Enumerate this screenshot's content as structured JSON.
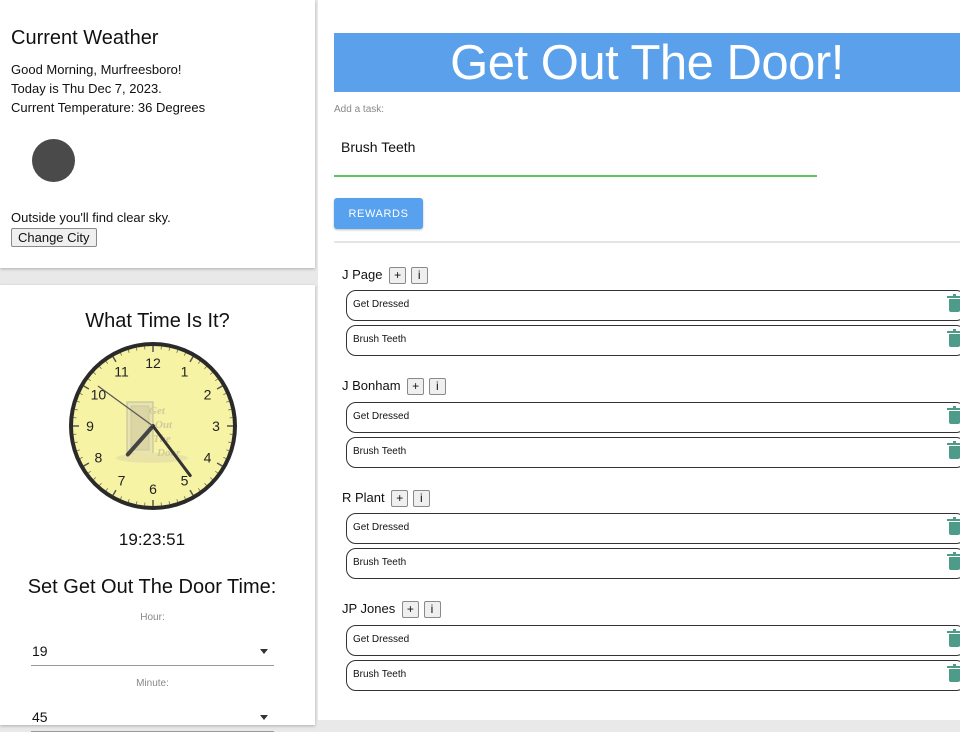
{
  "weather": {
    "title": "Current Weather",
    "greeting": "Good Morning, Murfreesboro!",
    "date_line": "Today is Thu Dec 7, 2023.",
    "temperature_line": "Current Temperature: 36 Degrees",
    "icon": "weather-condition-icon",
    "condition_line": "Outside you'll find clear sky.",
    "change_city_label": "Change City"
  },
  "clock": {
    "title": "What Time Is It?",
    "digital_time": "19:23:51",
    "face_numbers": [
      "12",
      "1",
      "2",
      "3",
      "4",
      "5",
      "6",
      "7",
      "8",
      "9",
      "10",
      "11"
    ],
    "face_color": "#f7f3a5",
    "set_title": "Set Get Out The Door Time:",
    "hour_label": "Hour:",
    "hour_value": "19",
    "minute_label": "Minute:",
    "minute_value": "45"
  },
  "main": {
    "banner_title": "Get Out The Door!",
    "banner_color": "#5aa0ea",
    "task_label": "Add a task:",
    "task_value": "Brush Teeth",
    "rewards_label": "REWARDS",
    "add_label": "+",
    "info_label": "i",
    "people": [
      {
        "name": "J Page",
        "tasks": [
          "Get Dressed",
          "Brush Teeth"
        ]
      },
      {
        "name": "J Bonham",
        "tasks": [
          "Get Dressed",
          "Brush Teeth"
        ]
      },
      {
        "name": "R Plant",
        "tasks": [
          "Get Dressed",
          "Brush Teeth"
        ]
      },
      {
        "name": "JP Jones",
        "tasks": [
          "Get Dressed",
          "Brush Teeth"
        ]
      }
    ]
  }
}
